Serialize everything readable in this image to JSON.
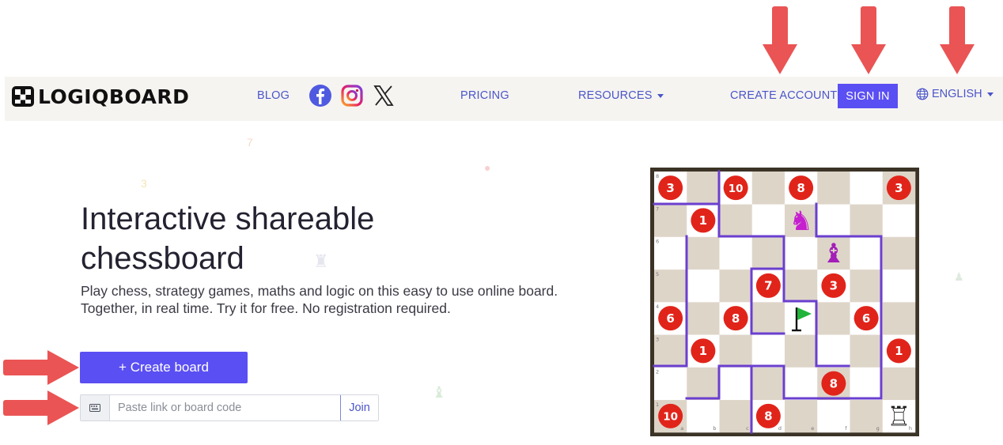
{
  "brand": {
    "name": "LOGIQBOARD"
  },
  "nav": {
    "blog": "BLOG",
    "pricing": "PRICING",
    "resources": "RESOURCES",
    "create_account": "CREATE ACCOUNT",
    "sign_in": "SIGN IN",
    "language": "ENGLISH"
  },
  "hero": {
    "title": "Interactive shareable chessboard",
    "description": "Play chess, strategy games, maths and logic on this easy to use online board. Together, in real time. Try it for free. No registration required.",
    "create_button": "+ Create board",
    "join_placeholder": "Paste link or board code",
    "join_button": "Join"
  },
  "board": {
    "files": [
      "a",
      "b",
      "c",
      "d",
      "e",
      "f",
      "g",
      "h"
    ],
    "ranks": [
      "1",
      "2",
      "3",
      "4",
      "5",
      "6",
      "7",
      "8"
    ],
    "tokens": [
      {
        "file": 0,
        "rank": 7,
        "value": "3"
      },
      {
        "file": 2,
        "rank": 7,
        "value": "10"
      },
      {
        "file": 4,
        "rank": 7,
        "value": "8"
      },
      {
        "file": 7,
        "rank": 7,
        "value": "3"
      },
      {
        "file": 1,
        "rank": 6,
        "value": "1"
      },
      {
        "file": 3,
        "rank": 4,
        "value": "7"
      },
      {
        "file": 5,
        "rank": 4,
        "value": "3"
      },
      {
        "file": 0,
        "rank": 3,
        "value": "6"
      },
      {
        "file": 2,
        "rank": 3,
        "value": "8"
      },
      {
        "file": 6,
        "rank": 3,
        "value": "6"
      },
      {
        "file": 1,
        "rank": 2,
        "value": "1"
      },
      {
        "file": 7,
        "rank": 2,
        "value": "1"
      },
      {
        "file": 5,
        "rank": 1,
        "value": "8"
      },
      {
        "file": 0,
        "rank": 0,
        "value": "10"
      },
      {
        "file": 3,
        "rank": 0,
        "value": "8"
      }
    ],
    "pieces": [
      {
        "file": 4,
        "rank": 6,
        "type": "knight",
        "color": "#c51fcf",
        "glyph": "♞"
      },
      {
        "file": 5,
        "rank": 5,
        "type": "bishop",
        "color": "#a31fb7",
        "glyph": "♝"
      },
      {
        "file": 7,
        "rank": 0,
        "type": "rook",
        "color": "#222222",
        "glyph": "♖"
      }
    ],
    "flag": {
      "file": 4,
      "rank": 3,
      "color": "#22b43a"
    },
    "colors": {
      "light": "#ffffff",
      "dark": "#ded5c9",
      "frame": "#3b3326",
      "wall": "#6a3fcf",
      "token": "#e1241a"
    }
  }
}
